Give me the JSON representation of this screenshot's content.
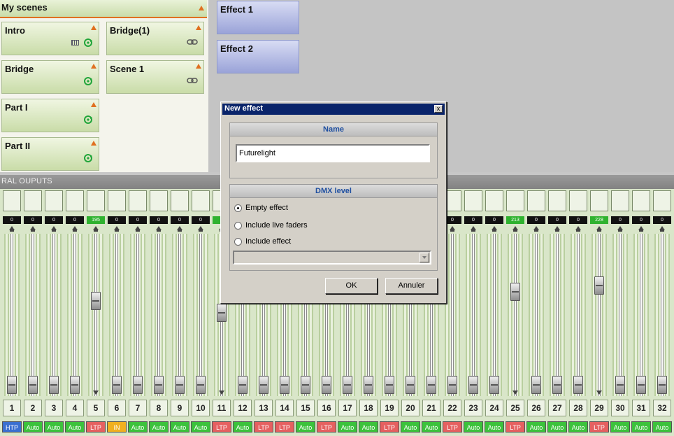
{
  "scenes": {
    "title": "My scenes",
    "items": [
      {
        "label": "Intro",
        "icons": [
          "keyboard-icon",
          "loop-icon"
        ]
      },
      {
        "label": "Bridge(1)",
        "icons": [
          "link-icon"
        ]
      },
      {
        "label": "Bridge",
        "icons": [
          "loop-icon"
        ]
      },
      {
        "label": "Scene 1",
        "icons": [
          "link-icon"
        ]
      },
      {
        "label": "Part I",
        "icons": [
          "loop-icon"
        ]
      },
      {
        "label": "Part II",
        "icons": [
          "loop-icon"
        ]
      }
    ]
  },
  "effects": {
    "items": [
      {
        "label": "Effect 1"
      },
      {
        "label": "Effect 2"
      }
    ]
  },
  "general": {
    "title": "RAL OUPUTS"
  },
  "channels": [
    {
      "num": "1",
      "value": "0",
      "mode": "HTP",
      "level": 0
    },
    {
      "num": "2",
      "value": "0",
      "mode": "Auto",
      "level": 0
    },
    {
      "num": "3",
      "value": "0",
      "mode": "Auto",
      "level": 0
    },
    {
      "num": "4",
      "value": "0",
      "mode": "Auto",
      "level": 0
    },
    {
      "num": "5",
      "value": "195",
      "mode": "LTP",
      "level": 0.76
    },
    {
      "num": "6",
      "value": "0",
      "mode": "IN",
      "level": 0
    },
    {
      "num": "7",
      "value": "0",
      "mode": "Auto",
      "level": 0
    },
    {
      "num": "8",
      "value": "0",
      "mode": "Auto",
      "level": 0
    },
    {
      "num": "9",
      "value": "0",
      "mode": "Auto",
      "level": 0
    },
    {
      "num": "10",
      "value": "0",
      "mode": "Auto",
      "level": 0
    },
    {
      "num": "11",
      "value": "",
      "mode": "LTP",
      "level": 0.65
    },
    {
      "num": "12",
      "value": "",
      "mode": "Auto",
      "level": 0
    },
    {
      "num": "13",
      "value": "",
      "mode": "LTP",
      "level": 0
    },
    {
      "num": "14",
      "value": "",
      "mode": "LTP",
      "level": 0
    },
    {
      "num": "15",
      "value": "",
      "mode": "Auto",
      "level": 0
    },
    {
      "num": "16",
      "value": "",
      "mode": "LTP",
      "level": 0
    },
    {
      "num": "17",
      "value": "",
      "mode": "Auto",
      "level": 0
    },
    {
      "num": "18",
      "value": "",
      "mode": "Auto",
      "level": 0
    },
    {
      "num": "19",
      "value": "",
      "mode": "LTP",
      "level": 0
    },
    {
      "num": "20",
      "value": "",
      "mode": "Auto",
      "level": 0
    },
    {
      "num": "21",
      "value": "",
      "mode": "Auto",
      "level": 0
    },
    {
      "num": "22",
      "value": "0",
      "mode": "LTP",
      "level": 0
    },
    {
      "num": "23",
      "value": "0",
      "mode": "Auto",
      "level": 0
    },
    {
      "num": "24",
      "value": "0",
      "mode": "Auto",
      "level": 0
    },
    {
      "num": "25",
      "value": "213",
      "mode": "LTP",
      "level": 0.84
    },
    {
      "num": "26",
      "value": "0",
      "mode": "Auto",
      "level": 0
    },
    {
      "num": "27",
      "value": "0",
      "mode": "Auto",
      "level": 0
    },
    {
      "num": "28",
      "value": "0",
      "mode": "Auto",
      "level": 0
    },
    {
      "num": "29",
      "value": "228",
      "mode": "LTP",
      "level": 0.9
    },
    {
      "num": "30",
      "value": "0",
      "mode": "Auto",
      "level": 0
    },
    {
      "num": "31",
      "value": "0",
      "mode": "Auto",
      "level": 0
    },
    {
      "num": "32",
      "value": "0",
      "mode": "Auto",
      "level": 0
    }
  ],
  "dialog": {
    "title": "New effect",
    "close_label": "x",
    "name_header": "Name",
    "name_value": "Futurelight",
    "dmx_header": "DMX level",
    "options": [
      {
        "label": "Empty effect",
        "selected": true
      },
      {
        "label": "Include live faders",
        "selected": false
      },
      {
        "label": "Include effect",
        "selected": false
      }
    ],
    "ok_label": "OK",
    "cancel_label": "Annuler"
  }
}
